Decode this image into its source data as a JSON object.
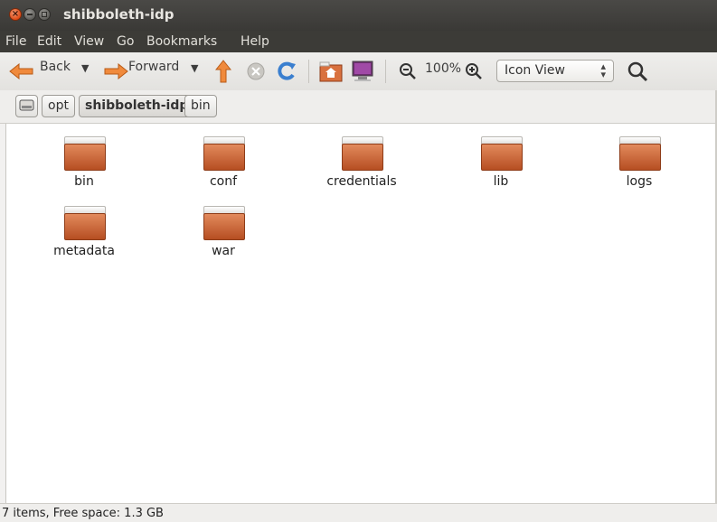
{
  "window": {
    "title": "shibboleth-idp"
  },
  "menu": [
    "File",
    "Edit",
    "View",
    "Go",
    "Bookmarks",
    "Help"
  ],
  "toolbar": {
    "back_label": "Back",
    "forward_label": "Forward",
    "zoom_level": "100%",
    "view_mode": "Icon View"
  },
  "path": [
    "opt",
    "shibboleth-idp",
    "bin"
  ],
  "folders": [
    {
      "name": "bin"
    },
    {
      "name": "conf"
    },
    {
      "name": "credentials"
    },
    {
      "name": "lib"
    },
    {
      "name": "logs"
    },
    {
      "name": "metadata"
    },
    {
      "name": "war"
    }
  ],
  "status": "7 items, Free space: 1.3 GB",
  "colors": {
    "titlebar": "#3c3b37",
    "folder": "#c86a3c",
    "close_button": "#df4b16"
  }
}
